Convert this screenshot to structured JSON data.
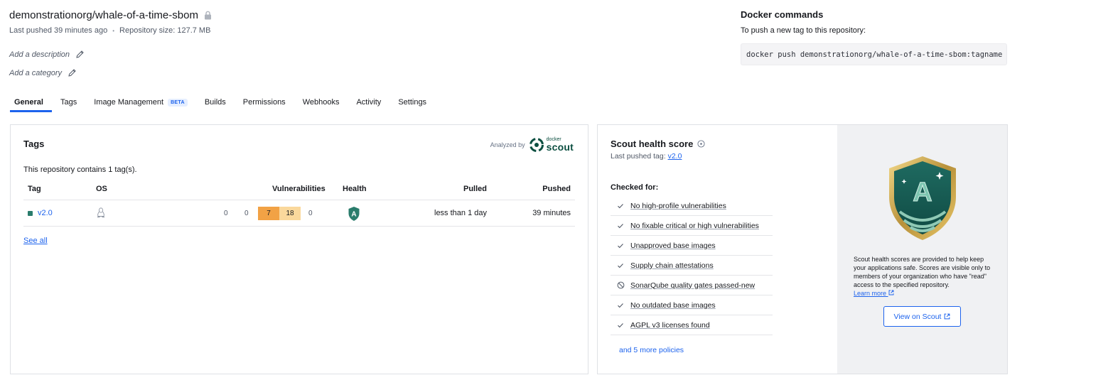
{
  "repo": {
    "title": "demonstrationorg/whale-of-a-time-sbom",
    "last_pushed": "Last pushed 39 minutes ago",
    "separator": "•",
    "size": "Repository size: 127.7 MB",
    "add_description": "Add a description",
    "add_category": "Add a category"
  },
  "docker_commands": {
    "title": "Docker commands",
    "subtitle": "To push a new tag to this repository:",
    "command": "docker push demonstrationorg/whale-of-a-time-sbom:tagname"
  },
  "tabs": [
    {
      "label": "General",
      "active": true
    },
    {
      "label": "Tags"
    },
    {
      "label": "Image Management",
      "badge": "BETA"
    },
    {
      "label": "Builds"
    },
    {
      "label": "Permissions"
    },
    {
      "label": "Webhooks"
    },
    {
      "label": "Activity"
    },
    {
      "label": "Settings"
    }
  ],
  "tags_panel": {
    "title": "Tags",
    "analyzed_by": "Analyzed by",
    "scout_small": "docker",
    "scout_big": "scout",
    "count_text": "This repository contains 1 tag(s).",
    "columns": {
      "tag": "Tag",
      "os": "OS",
      "vulnerabilities": "Vulnerabilities",
      "health": "Health",
      "pulled": "Pulled",
      "pushed": "Pushed"
    },
    "rows": [
      {
        "tag": "v2.0",
        "os_icon": "linux-icon",
        "vuln": {
          "critical": "0",
          "high": "0",
          "medium": "7",
          "low": "18",
          "unspecified": "0"
        },
        "health": "A",
        "pulled": "less than 1 day",
        "pushed": "39 minutes"
      }
    ],
    "see_all": "See all"
  },
  "scout_panel": {
    "title": "Scout health score",
    "last_pushed_label": "Last pushed tag:",
    "last_pushed_tag": "v2.0",
    "checked_for": "Checked for:",
    "policies": [
      {
        "label": "No high-profile vulnerabilities",
        "status": "check"
      },
      {
        "label": "No fixable critical or high vulnerabilities",
        "status": "check"
      },
      {
        "label": "Unapproved base images",
        "status": "check"
      },
      {
        "label": "Supply chain attestations",
        "status": "check"
      },
      {
        "label": "SonarQube quality gates passed-new",
        "status": "skipped"
      },
      {
        "label": "No outdated base images",
        "status": "check"
      },
      {
        "label": "AGPL v3 licenses found",
        "status": "check"
      }
    ],
    "more_policies": "and 5 more policies",
    "badge_grade": "A",
    "note": "Scout health scores are provided to help keep your applications safe. Scores are visible only to members of your organization who have \"read\" access to the specified repository.",
    "learn_more": "Learn more",
    "view_button": "View on Scout"
  },
  "colors": {
    "accent": "#1d63ed",
    "vuln_medium": "#f2a245",
    "vuln_low": "#fad89c",
    "scout_green": "#2a7c6c"
  }
}
